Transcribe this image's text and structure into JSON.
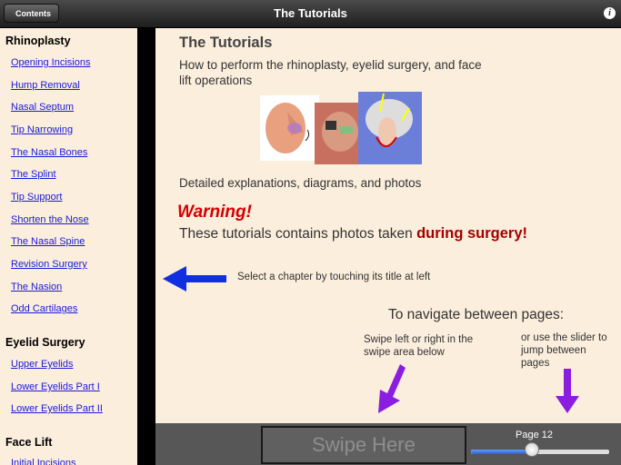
{
  "topbar": {
    "back_label": "Contents",
    "title": "The Tutorials",
    "info_icon": "info-icon"
  },
  "sidebar": {
    "sections": [
      {
        "title": "Rhinoplasty",
        "items": [
          "Opening Incisions",
          "Hump Removal",
          "Nasal Septum",
          "Tip Narrowing",
          "The Nasal Bones",
          "The Splint",
          "Tip Support",
          "Shorten the Nose",
          "The Nasal Spine",
          "Revision Surgery",
          "The Nasion",
          "Odd Cartilages"
        ]
      },
      {
        "title": "Eyelid Surgery",
        "items": [
          "Upper Eyelids",
          "Lower Eyelids Part I",
          "Lower Eyelids Part II"
        ]
      },
      {
        "title": "Face Lift",
        "items": [
          "Initial Incisions"
        ]
      }
    ]
  },
  "main": {
    "heading": "The Tutorials",
    "subtitle": "How to perform the rhinoplasty, eyelid surgery, and face lift operations",
    "detail": "Detailed explanations, diagrams, and photos",
    "warning": "Warning!",
    "contains_prefix": "These tutorials contains photos taken",
    "contains_emph": "during surgery!",
    "select_hint": "Select a chapter by touching its title at left",
    "navigate": "To navigate between pages:",
    "swipe_hint": "Swipe left or right in the swipe area below",
    "slider_hint": "or use the slider to jump between pages"
  },
  "bottom": {
    "swipe_label": "Swipe Here",
    "page_label": "Page 12",
    "slider_fraction": 0.45
  },
  "colors": {
    "link": "#1a1ad8",
    "warning": "#d40000",
    "emphasis": "#a50000",
    "blue_arrow": "#1030e0",
    "purple_arrow": "#8a1de0"
  }
}
